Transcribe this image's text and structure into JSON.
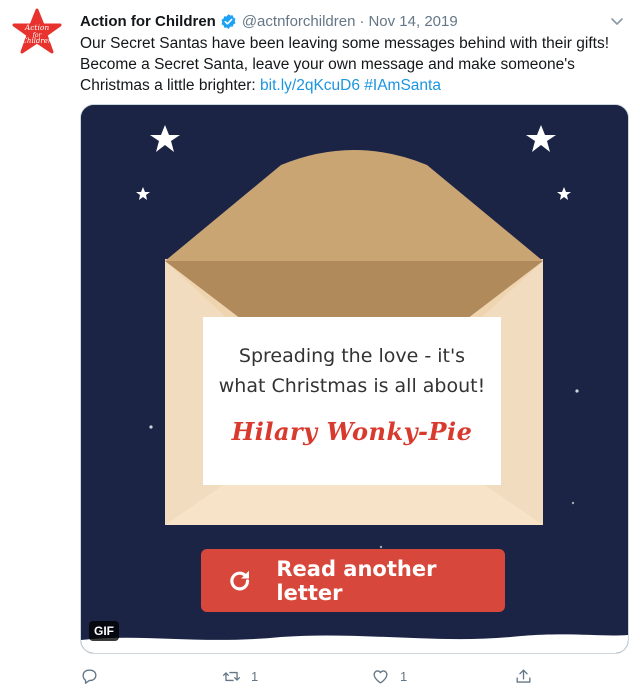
{
  "colors": {
    "brand_red": "#e8322d",
    "link_blue": "#1b95e0",
    "secondary_text": "#657786",
    "night_sky": "#1b2445",
    "button_red": "#d8473b",
    "signature_red": "#d93a2e"
  },
  "tweet": {
    "avatar_text": [
      "Action",
      "for",
      "Children"
    ],
    "author_name": "Action for Children",
    "verified_icon": "verified-badge-icon",
    "handle": "@actnforchildren",
    "separator": "·",
    "date": "Nov 14, 2019",
    "menu_icon": "chevron-down-icon",
    "text_plain": "Our Secret Santas have been leaving some messages behind with their gifts! Become a Secret Santa, leave your own message and make someone's Christmas a little brighter: ",
    "link_url": "bit.ly/2qKcuD6",
    "hashtag": "#IAmSanta"
  },
  "media": {
    "letter_line_1": "Spreading the love - it's",
    "letter_line_2": "what Christmas is all about!",
    "signature": "Hilary Wonky-Pie",
    "button_label": "Read another letter",
    "button_icon": "refresh-icon",
    "gif_badge": "GIF"
  },
  "actions": {
    "reply": {
      "icon": "reply-icon",
      "count": ""
    },
    "retweet": {
      "icon": "retweet-icon",
      "count": "1"
    },
    "like": {
      "icon": "heart-icon",
      "count": "1"
    },
    "share": {
      "icon": "share-icon",
      "count": ""
    }
  }
}
